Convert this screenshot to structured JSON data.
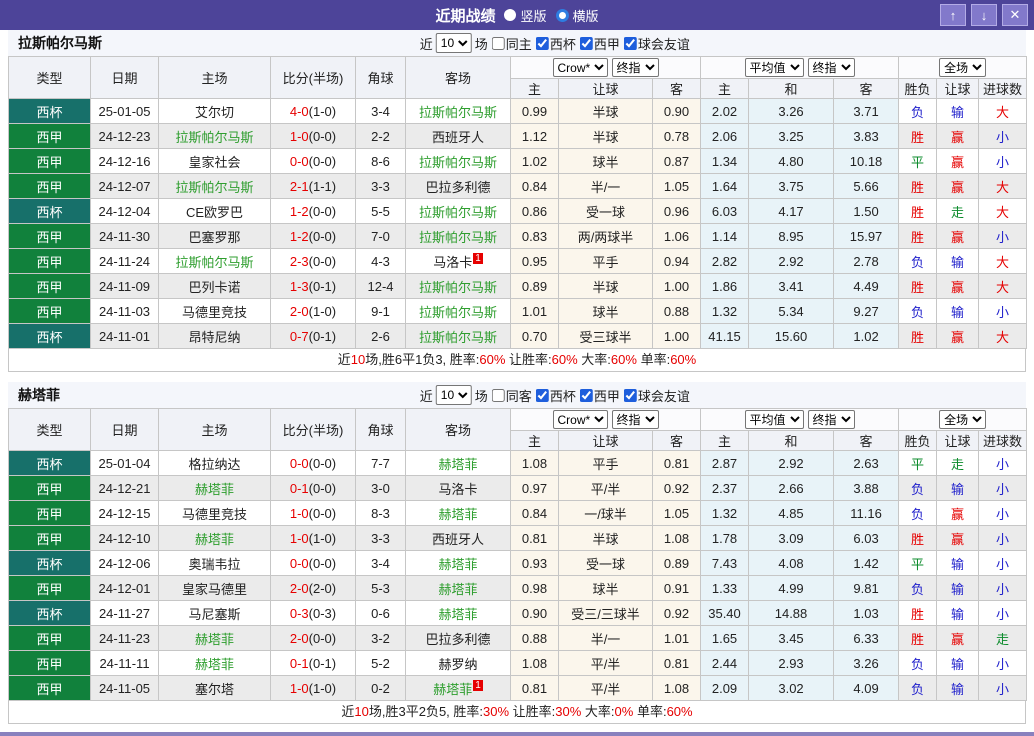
{
  "titlebar": {
    "title": "近期战绩",
    "layout_options": [
      {
        "label": "竖版",
        "selected": true
      },
      {
        "label": "横版",
        "selected": false
      }
    ],
    "buttons": {
      "up": "↑",
      "down": "↓",
      "close": "✕"
    }
  },
  "columns": {
    "type": "类型",
    "date": "日期",
    "home": "主场",
    "score": "比分(半场)",
    "corner": "角球",
    "away": "客场",
    "h_home": "主",
    "h_line": "让球",
    "h_away": "客",
    "a_home": "主",
    "a_draw": "和",
    "a_away": "客",
    "r_wdl": "胜负",
    "r_handicap": "让球",
    "r_goals": "进球数"
  },
  "controls": {
    "odds_source": "Crow*",
    "odds_stage": "终指",
    "avg_label": "平均值",
    "avg_stage": "终指",
    "scope": "全场"
  },
  "result_classes": {
    "胜": "win",
    "赢": "win",
    "大": "win",
    "平": "draw",
    "走": "draw",
    "负": "lose",
    "输": "lose",
    "小": "lose"
  },
  "colors": {
    "titlebar_purple": "#4D4499",
    "button_purple": "#8279CB",
    "bottom_bar": "#8981BE",
    "cup_badge": "#17706A",
    "league_badge": "#11813C",
    "team_green": "#2E9E2E",
    "win_red": "#E60000",
    "lose_blue": "#2121CC",
    "draw_green": "#0B8B2B",
    "handicap_col_bg": "#FBF6EC",
    "avg_col_bg": "#E8F3F8",
    "alt_row_bg": "#EBEBEB"
  },
  "sections": [
    {
      "team": "拉斯帕尔马斯",
      "filter": {
        "prefix": "近",
        "count": "10",
        "suffix": "场",
        "venue_label": "同主",
        "venue_checked": false,
        "leagues": [
          {
            "label": "西杯",
            "checked": true
          },
          {
            "label": "西甲",
            "checked": true
          },
          {
            "label": "球会友谊",
            "checked": true
          }
        ]
      },
      "rows": [
        {
          "type": "西杯",
          "cup": true,
          "date": "25-01-05",
          "home": "艾尔切",
          "home_team": false,
          "home_rc": "",
          "score": "4-0",
          "half": "(1-0)",
          "corner": "3-4",
          "away": "拉斯帕尔马斯",
          "away_team": true,
          "away_rc": "",
          "hh": "0.99",
          "line": "半球",
          "ha": "0.90",
          "avg_h": "2.02",
          "avg_d": "3.26",
          "avg_a": "3.71",
          "r1": "负",
          "r2": "输",
          "r3": "大"
        },
        {
          "type": "西甲",
          "cup": false,
          "date": "24-12-23",
          "home": "拉斯帕尔马斯",
          "home_team": true,
          "home_rc": "",
          "score": "1-0",
          "half": "(0-0)",
          "corner": "2-2",
          "away": "西班牙人",
          "away_team": false,
          "away_rc": "",
          "hh": "1.12",
          "line": "半球",
          "ha": "0.78",
          "avg_h": "2.06",
          "avg_d": "3.25",
          "avg_a": "3.83",
          "r1": "胜",
          "r2": "赢",
          "r3": "小"
        },
        {
          "type": "西甲",
          "cup": false,
          "date": "24-12-16",
          "home": "皇家社会",
          "home_team": false,
          "home_rc": "",
          "score": "0-0",
          "half": "(0-0)",
          "corner": "8-6",
          "away": "拉斯帕尔马斯",
          "away_team": true,
          "away_rc": "",
          "hh": "1.02",
          "line": "球半",
          "ha": "0.87",
          "avg_h": "1.34",
          "avg_d": "4.80",
          "avg_a": "10.18",
          "r1": "平",
          "r2": "赢",
          "r3": "小"
        },
        {
          "type": "西甲",
          "cup": false,
          "date": "24-12-07",
          "home": "拉斯帕尔马斯",
          "home_team": true,
          "home_rc": "",
          "score": "2-1",
          "half": "(1-1)",
          "corner": "3-3",
          "away": "巴拉多利德",
          "away_team": false,
          "away_rc": "",
          "hh": "0.84",
          "line": "半/一",
          "ha": "1.05",
          "avg_h": "1.64",
          "avg_d": "3.75",
          "avg_a": "5.66",
          "r1": "胜",
          "r2": "赢",
          "r3": "大"
        },
        {
          "type": "西杯",
          "cup": true,
          "date": "24-12-04",
          "home": "CE欧罗巴",
          "home_team": false,
          "home_rc": "",
          "score": "1-2",
          "half": "(0-0)",
          "corner": "5-5",
          "away": "拉斯帕尔马斯",
          "away_team": true,
          "away_rc": "",
          "hh": "0.86",
          "line": "受一球",
          "ha": "0.96",
          "avg_h": "6.03",
          "avg_d": "4.17",
          "avg_a": "1.50",
          "r1": "胜",
          "r2": "走",
          "r3": "大"
        },
        {
          "type": "西甲",
          "cup": false,
          "date": "24-11-30",
          "home": "巴塞罗那",
          "home_team": false,
          "home_rc": "",
          "score": "1-2",
          "half": "(0-0)",
          "corner": "7-0",
          "away": "拉斯帕尔马斯",
          "away_team": true,
          "away_rc": "",
          "hh": "0.83",
          "line": "两/两球半",
          "ha": "1.06",
          "avg_h": "1.14",
          "avg_d": "8.95",
          "avg_a": "15.97",
          "r1": "胜",
          "r2": "赢",
          "r3": "小"
        },
        {
          "type": "西甲",
          "cup": false,
          "date": "24-11-24",
          "home": "拉斯帕尔马斯",
          "home_team": true,
          "home_rc": "",
          "score": "2-3",
          "half": "(0-0)",
          "corner": "4-3",
          "away": "马洛卡",
          "away_team": false,
          "away_rc": "1",
          "hh": "0.95",
          "line": "平手",
          "ha": "0.94",
          "avg_h": "2.82",
          "avg_d": "2.92",
          "avg_a": "2.78",
          "r1": "负",
          "r2": "输",
          "r3": "大"
        },
        {
          "type": "西甲",
          "cup": false,
          "date": "24-11-09",
          "home": "巴列卡诺",
          "home_team": false,
          "home_rc": "",
          "score": "1-3",
          "half": "(0-1)",
          "corner": "12-4",
          "away": "拉斯帕尔马斯",
          "away_team": true,
          "away_rc": "",
          "hh": "0.89",
          "line": "半球",
          "ha": "1.00",
          "avg_h": "1.86",
          "avg_d": "3.41",
          "avg_a": "4.49",
          "r1": "胜",
          "r2": "赢",
          "r3": "大"
        },
        {
          "type": "西甲",
          "cup": false,
          "date": "24-11-03",
          "home": "马德里竞技",
          "home_team": false,
          "home_rc": "",
          "score": "2-0",
          "half": "(1-0)",
          "corner": "9-1",
          "away": "拉斯帕尔马斯",
          "away_team": true,
          "away_rc": "",
          "hh": "1.01",
          "line": "球半",
          "ha": "0.88",
          "avg_h": "1.32",
          "avg_d": "5.34",
          "avg_a": "9.27",
          "r1": "负",
          "r2": "输",
          "r3": "小"
        },
        {
          "type": "西杯",
          "cup": true,
          "date": "24-11-01",
          "home": "昂特尼纳",
          "home_team": false,
          "home_rc": "",
          "score": "0-7",
          "half": "(0-1)",
          "corner": "2-6",
          "away": "拉斯帕尔马斯",
          "away_team": true,
          "away_rc": "",
          "hh": "0.70",
          "line": "受三球半",
          "ha": "1.00",
          "avg_h": "41.15",
          "avg_d": "15.60",
          "avg_a": "1.02",
          "r1": "胜",
          "r2": "赢",
          "r3": "大"
        }
      ],
      "summary": [
        {
          "t": "近"
        },
        {
          "t": "10",
          "red": true
        },
        {
          "t": "场,胜6平1负3, 胜率:"
        },
        {
          "t": "60%",
          "red": true
        },
        {
          "t": " 让胜率:"
        },
        {
          "t": "60%",
          "red": true
        },
        {
          "t": " 大率:"
        },
        {
          "t": "60%",
          "red": true
        },
        {
          "t": " 单率:"
        },
        {
          "t": "60%",
          "red": true
        }
      ]
    },
    {
      "team": "赫塔菲",
      "filter": {
        "prefix": "近",
        "count": "10",
        "suffix": "场",
        "venue_label": "同客",
        "venue_checked": false,
        "leagues": [
          {
            "label": "西杯",
            "checked": true
          },
          {
            "label": "西甲",
            "checked": true
          },
          {
            "label": "球会友谊",
            "checked": true
          }
        ]
      },
      "rows": [
        {
          "type": "西杯",
          "cup": true,
          "date": "25-01-04",
          "home": "格拉纳达",
          "home_team": false,
          "home_rc": "",
          "score": "0-0",
          "half": "(0-0)",
          "corner": "7-7",
          "away": "赫塔菲",
          "away_team": true,
          "away_rc": "",
          "hh": "1.08",
          "line": "平手",
          "ha": "0.81",
          "avg_h": "2.87",
          "avg_d": "2.92",
          "avg_a": "2.63",
          "r1": "平",
          "r2": "走",
          "r3": "小"
        },
        {
          "type": "西甲",
          "cup": false,
          "date": "24-12-21",
          "home": "赫塔菲",
          "home_team": true,
          "home_rc": "",
          "score": "0-1",
          "half": "(0-0)",
          "corner": "3-0",
          "away": "马洛卡",
          "away_team": false,
          "away_rc": "",
          "hh": "0.97",
          "line": "平/半",
          "ha": "0.92",
          "avg_h": "2.37",
          "avg_d": "2.66",
          "avg_a": "3.88",
          "r1": "负",
          "r2": "输",
          "r3": "小"
        },
        {
          "type": "西甲",
          "cup": false,
          "date": "24-12-15",
          "home": "马德里竞技",
          "home_team": false,
          "home_rc": "",
          "score": "1-0",
          "half": "(0-0)",
          "corner": "8-3",
          "away": "赫塔菲",
          "away_team": true,
          "away_rc": "",
          "hh": "0.84",
          "line": "一/球半",
          "ha": "1.05",
          "avg_h": "1.32",
          "avg_d": "4.85",
          "avg_a": "11.16",
          "r1": "负",
          "r2": "赢",
          "r3": "小"
        },
        {
          "type": "西甲",
          "cup": false,
          "date": "24-12-10",
          "home": "赫塔菲",
          "home_team": true,
          "home_rc": "",
          "score": "1-0",
          "half": "(1-0)",
          "corner": "3-3",
          "away": "西班牙人",
          "away_team": false,
          "away_rc": "",
          "hh": "0.81",
          "line": "半球",
          "ha": "1.08",
          "avg_h": "1.78",
          "avg_d": "3.09",
          "avg_a": "6.03",
          "r1": "胜",
          "r2": "赢",
          "r3": "小"
        },
        {
          "type": "西杯",
          "cup": true,
          "date": "24-12-06",
          "home": "奥瑞韦拉",
          "home_team": false,
          "home_rc": "",
          "score": "0-0",
          "half": "(0-0)",
          "corner": "3-4",
          "away": "赫塔菲",
          "away_team": true,
          "away_rc": "",
          "hh": "0.93",
          "line": "受一球",
          "ha": "0.89",
          "avg_h": "7.43",
          "avg_d": "4.08",
          "avg_a": "1.42",
          "r1": "平",
          "r2": "输",
          "r3": "小"
        },
        {
          "type": "西甲",
          "cup": false,
          "date": "24-12-01",
          "home": "皇家马德里",
          "home_team": false,
          "home_rc": "",
          "score": "2-0",
          "half": "(2-0)",
          "corner": "5-3",
          "away": "赫塔菲",
          "away_team": true,
          "away_rc": "",
          "hh": "0.98",
          "line": "球半",
          "ha": "0.91",
          "avg_h": "1.33",
          "avg_d": "4.99",
          "avg_a": "9.81",
          "r1": "负",
          "r2": "输",
          "r3": "小"
        },
        {
          "type": "西杯",
          "cup": true,
          "date": "24-11-27",
          "home": "马尼塞斯",
          "home_team": false,
          "home_rc": "",
          "score": "0-3",
          "half": "(0-3)",
          "corner": "0-6",
          "away": "赫塔菲",
          "away_team": true,
          "away_rc": "",
          "hh": "0.90",
          "line": "受三/三球半",
          "ha": "0.92",
          "avg_h": "35.40",
          "avg_d": "14.88",
          "avg_a": "1.03",
          "r1": "胜",
          "r2": "输",
          "r3": "小"
        },
        {
          "type": "西甲",
          "cup": false,
          "date": "24-11-23",
          "home": "赫塔菲",
          "home_team": true,
          "home_rc": "",
          "score": "2-0",
          "half": "(0-0)",
          "corner": "3-2",
          "away": "巴拉多利德",
          "away_team": false,
          "away_rc": "",
          "hh": "0.88",
          "line": "半/一",
          "ha": "1.01",
          "avg_h": "1.65",
          "avg_d": "3.45",
          "avg_a": "6.33",
          "r1": "胜",
          "r2": "赢",
          "r3": "走"
        },
        {
          "type": "西甲",
          "cup": false,
          "date": "24-11-11",
          "home": "赫塔菲",
          "home_team": true,
          "home_rc": "",
          "score": "0-1",
          "half": "(0-1)",
          "corner": "5-2",
          "away": "赫罗纳",
          "away_team": false,
          "away_rc": "",
          "hh": "1.08",
          "line": "平/半",
          "ha": "0.81",
          "avg_h": "2.44",
          "avg_d": "2.93",
          "avg_a": "3.26",
          "r1": "负",
          "r2": "输",
          "r3": "小"
        },
        {
          "type": "西甲",
          "cup": false,
          "date": "24-11-05",
          "home": "塞尔塔",
          "home_team": false,
          "home_rc": "",
          "score": "1-0",
          "half": "(1-0)",
          "corner": "0-2",
          "away": "赫塔菲",
          "away_team": true,
          "away_rc": "1",
          "hh": "0.81",
          "line": "平/半",
          "ha": "1.08",
          "avg_h": "2.09",
          "avg_d": "3.02",
          "avg_a": "4.09",
          "r1": "负",
          "r2": "输",
          "r3": "小"
        }
      ],
      "summary": [
        {
          "t": "近"
        },
        {
          "t": "10",
          "red": true
        },
        {
          "t": "场,胜3平2负5, 胜率:"
        },
        {
          "t": "30%",
          "red": true
        },
        {
          "t": " 让胜率:"
        },
        {
          "t": "30%",
          "red": true
        },
        {
          "t": " 大率:"
        },
        {
          "t": "0%",
          "red": true
        },
        {
          "t": " 单率:"
        },
        {
          "t": "60%",
          "red": true
        }
      ]
    }
  ]
}
